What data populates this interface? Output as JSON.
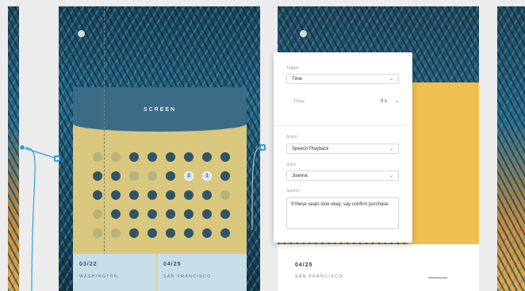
{
  "screen_title": "SCREEN",
  "seat_rows": [
    [
      "avail",
      "avail",
      "taken",
      "taken",
      "taken",
      "taken",
      "taken",
      "taken"
    ],
    [
      "taken",
      "taken",
      "avail",
      "avail",
      "taken",
      "sel",
      "sel",
      "taken"
    ],
    [
      "taken",
      "taken",
      "taken",
      "taken",
      "taken",
      "taken",
      "taken",
      "avail"
    ],
    [
      "avail",
      "taken",
      "taken",
      "taken",
      "taken",
      "taken",
      "taken",
      "taken"
    ],
    [
      "avail",
      "avail",
      "taken",
      "taken",
      "taken",
      "taken",
      "taken",
      "taken"
    ]
  ],
  "selected_seats": [
    "2",
    "1"
  ],
  "tickets": [
    {
      "date": "03/22",
      "city": "WASHINGTON"
    },
    {
      "date": "04/25",
      "city": "SAN FRANCISCO"
    }
  ],
  "artboard2_ticket": {
    "date": "04/25",
    "city": "SAN FRANCISCO"
  },
  "panel": {
    "trigger_label": "Trigger",
    "trigger_value": "Time",
    "delay_label": "Delay",
    "delay_value": "0 s",
    "action_label": "Action",
    "action_value": "Speech Playback",
    "voice_label": "Voice",
    "voice_value": "Joanna",
    "speech_label": "Speech",
    "speech_text": "If these seats look okay, say confirm purchase."
  },
  "colors": {
    "accent": "#2d9cdb",
    "seat_taken": "#2f5468",
    "seat_available": "#b7b27c",
    "card_yellow": "#d9c77d",
    "header_blue": "#3c6b86",
    "highlight_yellow": "#f0c04e"
  },
  "icons": [
    "logo-icon",
    "chevron-down-icon",
    "connector-handle-icon"
  ]
}
